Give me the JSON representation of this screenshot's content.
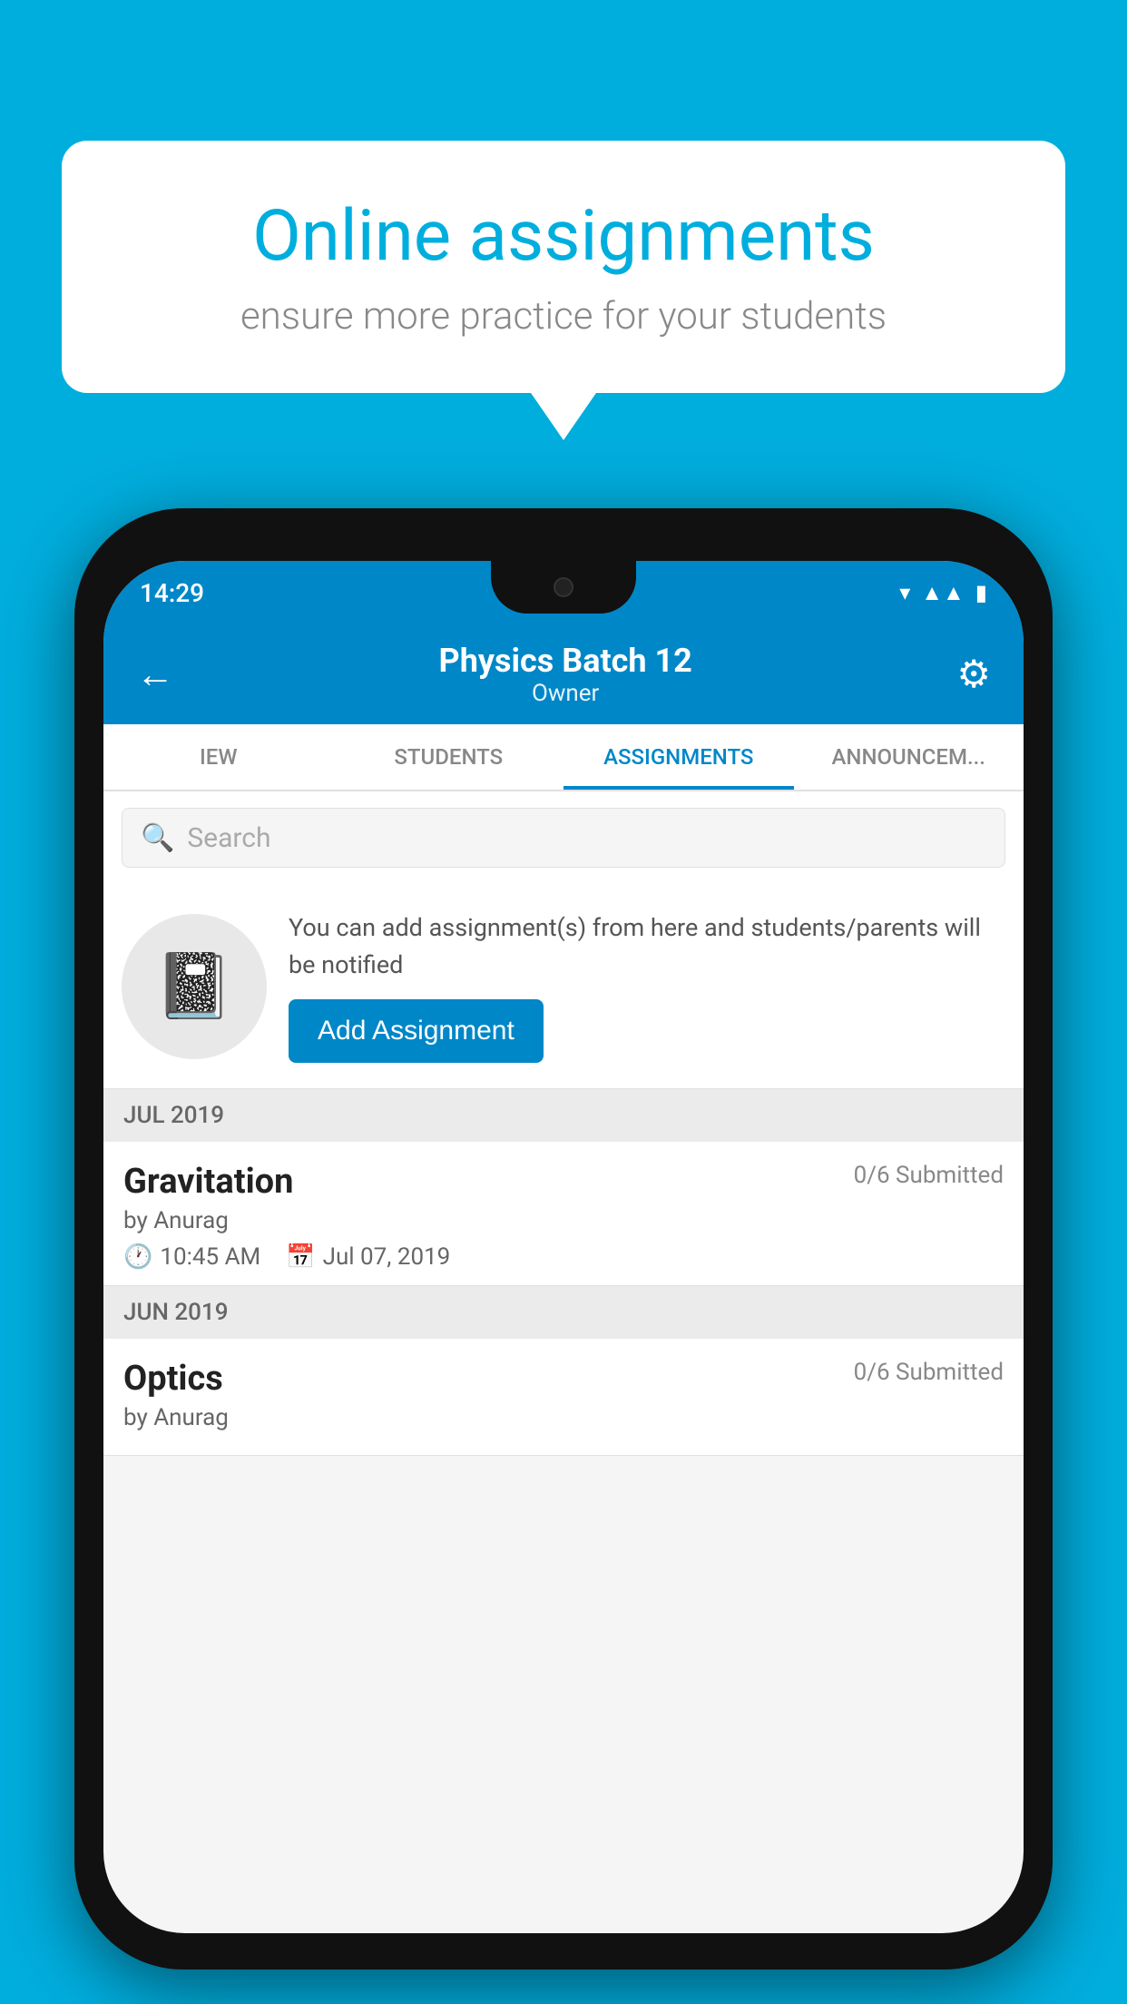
{
  "background_color": "#00AEDE",
  "speech_bubble": {
    "title": "Online assignments",
    "subtitle": "ensure more practice for your students"
  },
  "phone": {
    "status_bar": {
      "time": "14:29"
    },
    "header": {
      "title": "Physics Batch 12",
      "subtitle": "Owner",
      "back_label": "←",
      "settings_label": "⚙"
    },
    "tabs": [
      {
        "label": "IEW",
        "active": false
      },
      {
        "label": "STUDENTS",
        "active": false
      },
      {
        "label": "ASSIGNMENTS",
        "active": true
      },
      {
        "label": "ANNOUNCEM...",
        "active": false
      }
    ],
    "search": {
      "placeholder": "Search"
    },
    "empty_state": {
      "description": "You can add assignment(s) from here and students/parents will be notified",
      "button_label": "Add Assignment"
    },
    "sections": [
      {
        "month": "JUL 2019",
        "assignments": [
          {
            "name": "Gravitation",
            "submitted": "0/6 Submitted",
            "author": "by Anurag",
            "time": "10:45 AM",
            "date": "Jul 07, 2019"
          }
        ]
      },
      {
        "month": "JUN 2019",
        "assignments": [
          {
            "name": "Optics",
            "submitted": "0/6 Submitted",
            "author": "by Anurag",
            "time": "",
            "date": ""
          }
        ]
      }
    ]
  }
}
